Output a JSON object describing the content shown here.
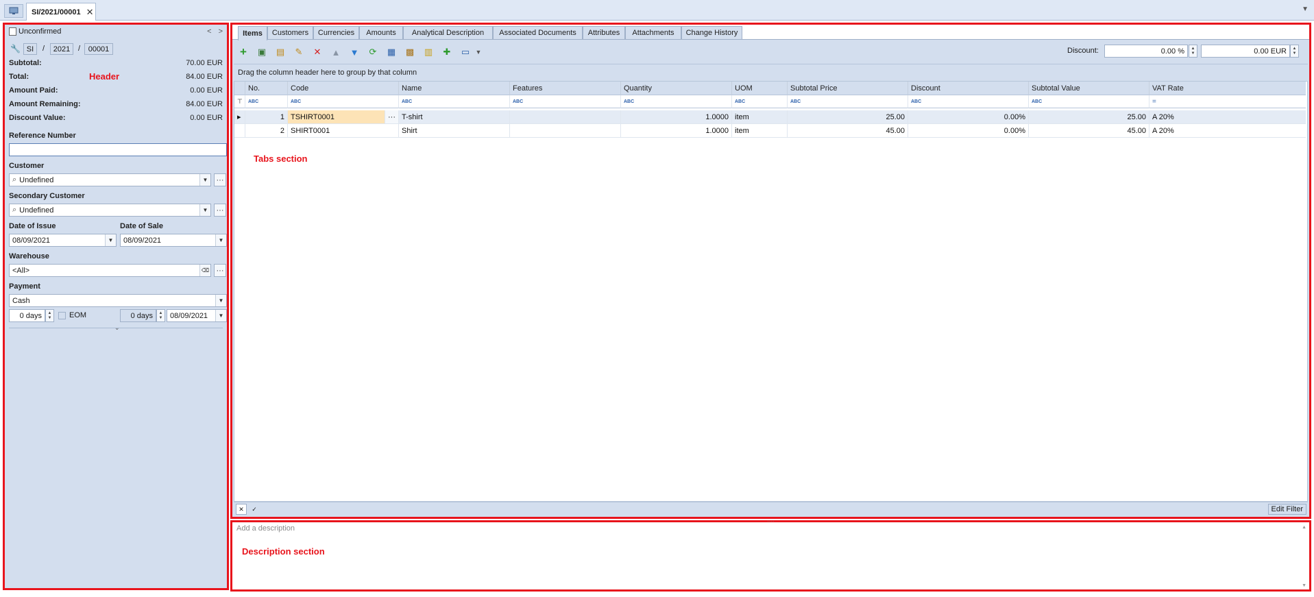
{
  "window": {
    "tab_title": "SI/2021/00001",
    "close_glyph": "✕"
  },
  "header": {
    "status": "Unconfirmed",
    "number": {
      "prefix": "SI",
      "year": "2021",
      "seq": "00001",
      "sep": "/"
    },
    "summary": [
      {
        "label": "Subtotal:",
        "value": "70.00 EUR"
      },
      {
        "label": "Total:",
        "value": "84.00 EUR"
      },
      {
        "label": "Amount Paid:",
        "value": "0.00 EUR"
      },
      {
        "label": "Amount Remaining:",
        "value": "84.00 EUR"
      },
      {
        "label": "Discount Value:",
        "value": "0.00 EUR"
      }
    ],
    "annotation": "Header",
    "reference_number_label": "Reference Number",
    "reference_number_value": "",
    "customer_label": "Customer",
    "customer_value": "Undefined",
    "secondary_customer_label": "Secondary Customer",
    "secondary_customer_value": "Undefined",
    "date_of_issue_label": "Date of Issue",
    "date_of_issue_value": "08/09/2021",
    "date_of_sale_label": "Date of Sale",
    "date_of_sale_value": "08/09/2021",
    "warehouse_label": "Warehouse",
    "warehouse_value": "<All>",
    "payment_label": "Payment",
    "payment_value": "Cash",
    "days1": "0 days",
    "eom_label": "EOM",
    "days2": "0 days",
    "due_date": "08/09/2021"
  },
  "tabs": [
    {
      "label": "Items",
      "active": true
    },
    {
      "label": "Customers"
    },
    {
      "label": "Currencies"
    },
    {
      "label": "Amounts"
    },
    {
      "label": "Analytical Description"
    },
    {
      "label": "Associated Documents"
    },
    {
      "label": "Attributes"
    },
    {
      "label": "Attachments"
    },
    {
      "label": "Change History"
    }
  ],
  "toolbar": {
    "discount_label": "Discount:",
    "discount_percent": "0.00 %",
    "discount_amount": "0.00 EUR"
  },
  "grid": {
    "group_hint": "Drag the column header here to group by that column",
    "columns": [
      "No.",
      "Code",
      "Name",
      "Features",
      "Quantity",
      "UOM",
      "Subtotal Price",
      "Discount",
      "Subtotal Value",
      "VAT Rate"
    ],
    "filter_abc": "ABC",
    "rows": [
      {
        "no": "1",
        "code": "TSHIRT0001",
        "name": "T-shirt",
        "features": "",
        "quantity": "1.0000",
        "uom": "item",
        "subtotal_price": "25.00",
        "discount": "0.00%",
        "subtotal_value": "25.00",
        "vat_rate": "A 20%"
      },
      {
        "no": "2",
        "code": "SHIRT0001",
        "name": "Shirt",
        "features": "",
        "quantity": "1.0000",
        "uom": "item",
        "subtotal_price": "45.00",
        "discount": "0.00%",
        "subtotal_value": "45.00",
        "vat_rate": "A 20%"
      }
    ],
    "annotation": "Tabs section",
    "edit_filter": "Edit Filter"
  },
  "description": {
    "placeholder": "Add a description",
    "annotation": "Description section"
  },
  "colors": {
    "panel": "#d3deee",
    "annotation_red": "#e8141c",
    "selected_cell": "#fde3b6"
  }
}
